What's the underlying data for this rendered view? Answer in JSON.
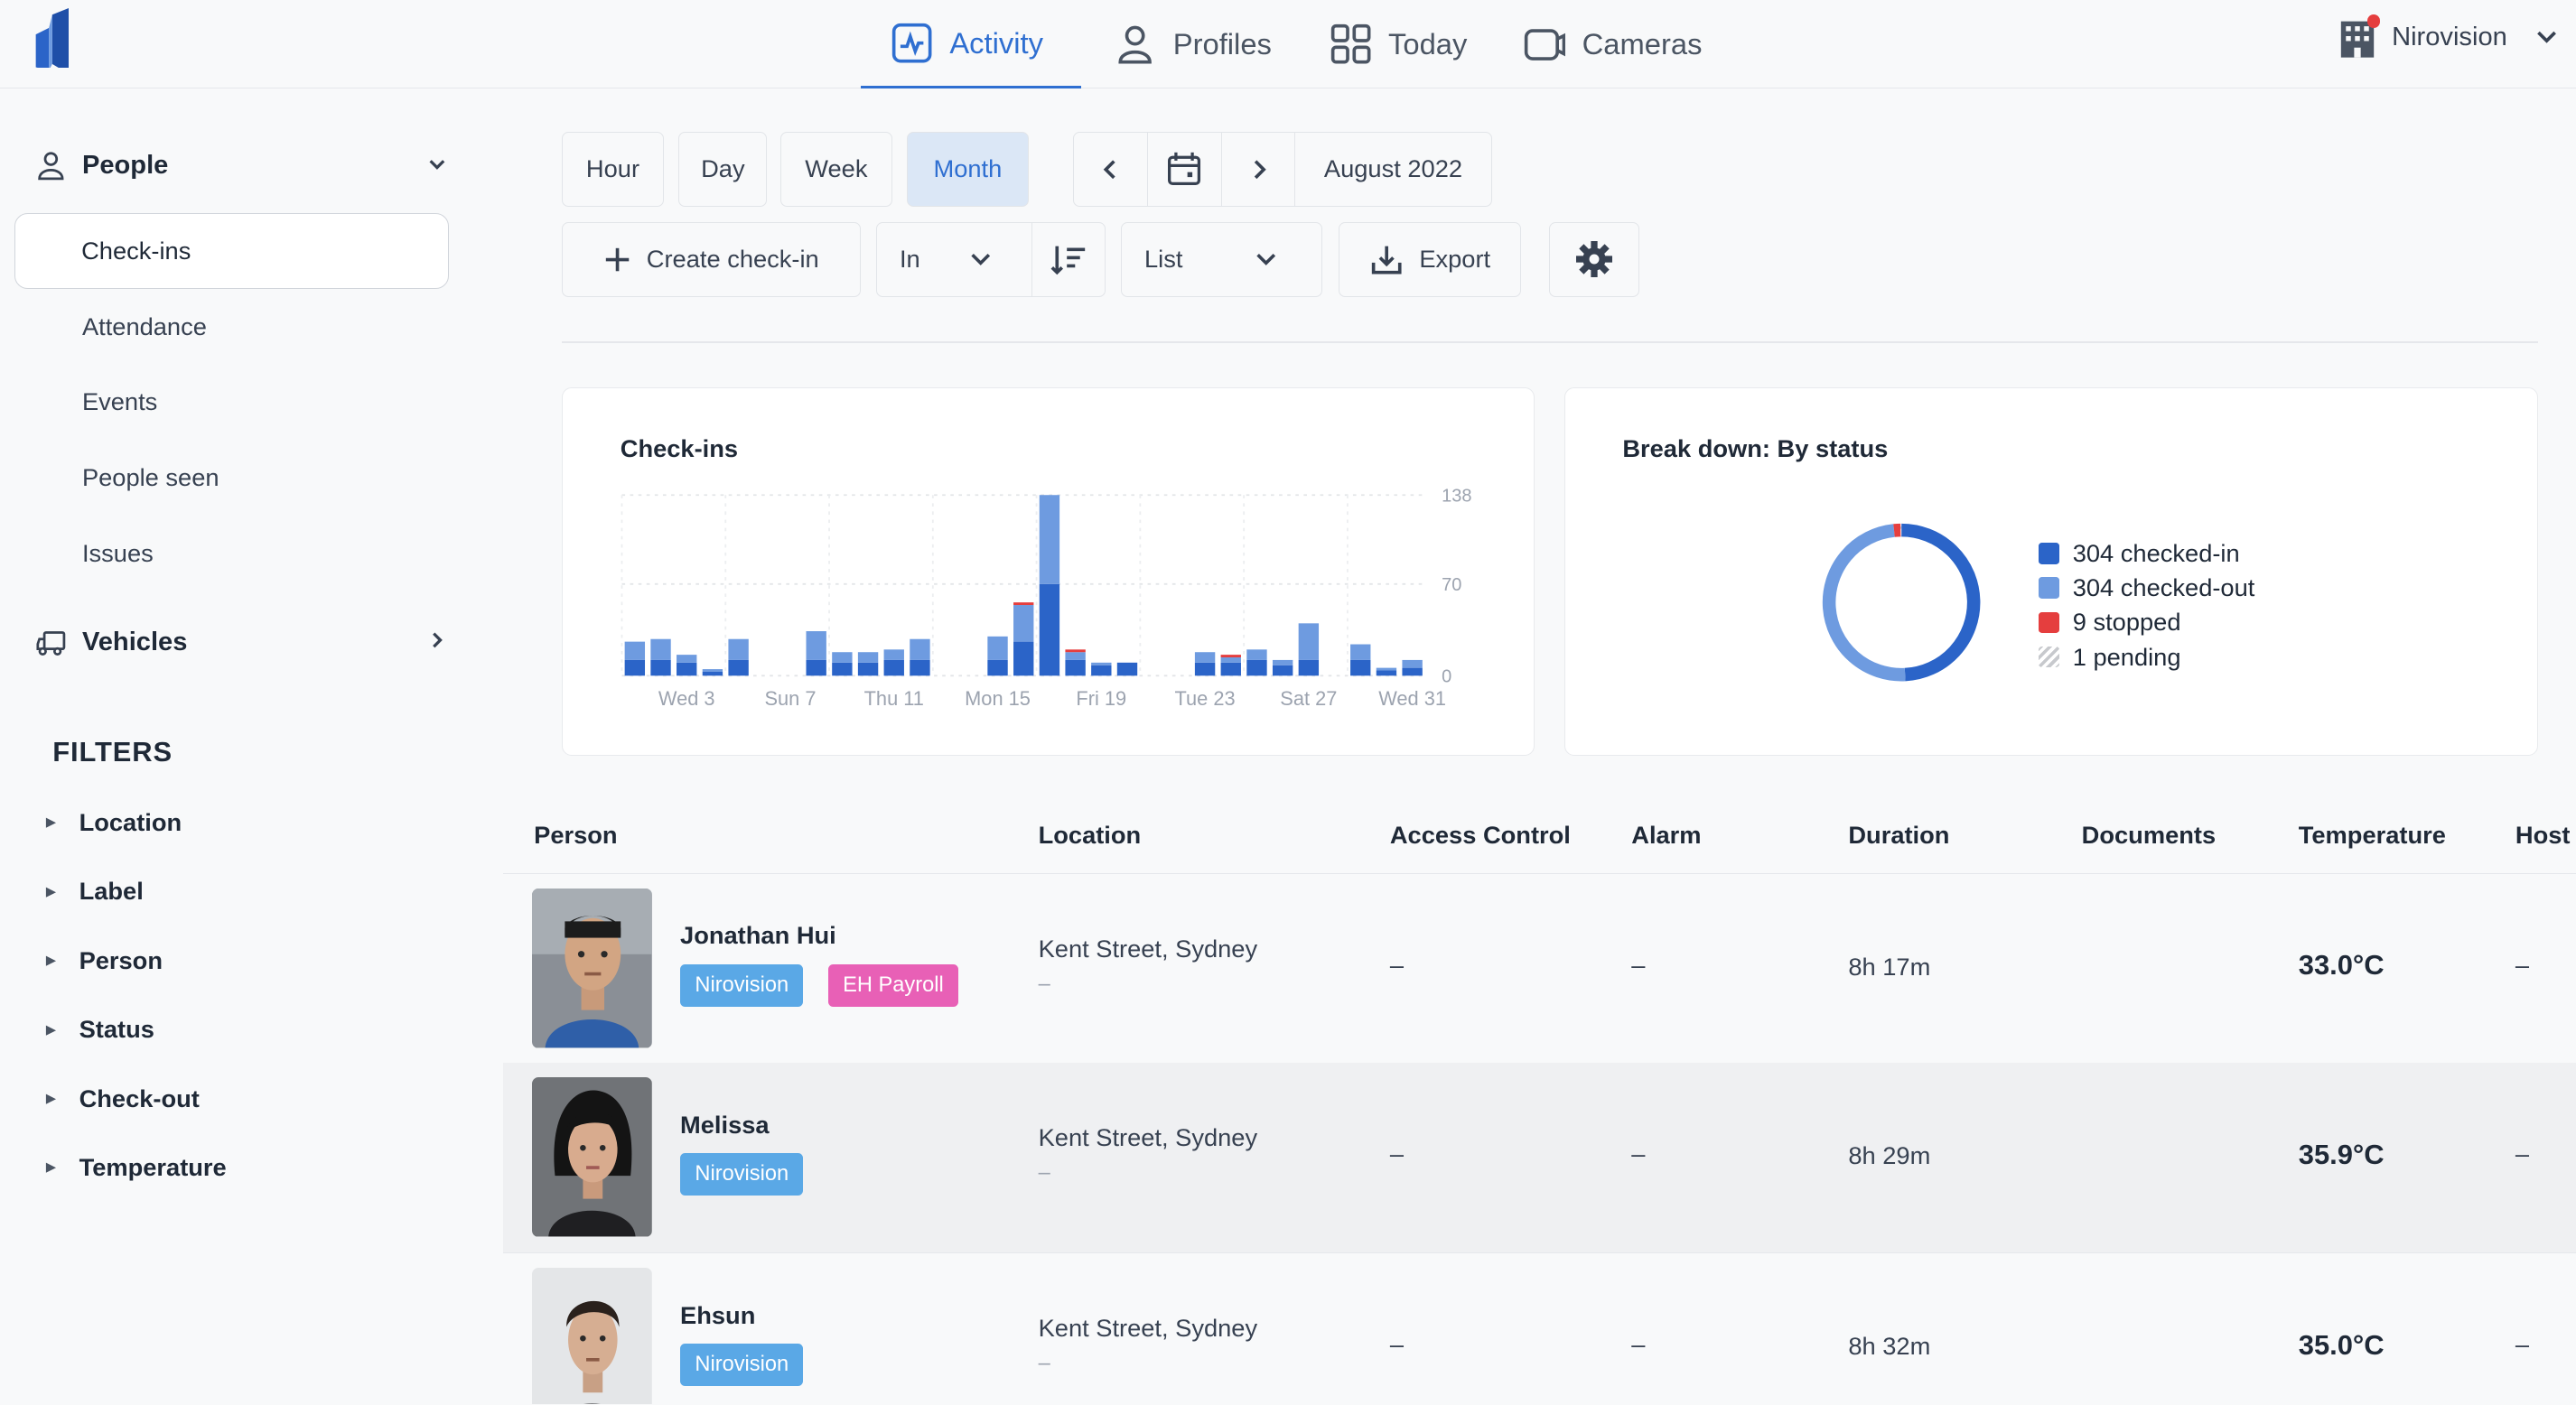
{
  "nav": {
    "tabs": [
      {
        "label": "Activity",
        "icon": "activity-icon"
      },
      {
        "label": "Profiles",
        "icon": "profile-icon"
      },
      {
        "label": "Today",
        "icon": "grid-icon"
      },
      {
        "label": "Cameras",
        "icon": "camera-icon"
      }
    ],
    "org_name": "Nirovision"
  },
  "sidebar": {
    "people_label": "People",
    "people_items": [
      "Check-ins",
      "Attendance",
      "Events",
      "People seen",
      "Issues"
    ],
    "vehicles_label": "Vehicles",
    "filters_title": "FILTERS",
    "filters": [
      "Location",
      "Label",
      "Person",
      "Status",
      "Check-out",
      "Temperature"
    ]
  },
  "toolbar": {
    "ranges": [
      "Hour",
      "Day",
      "Week",
      "Month"
    ],
    "active_range": "Month",
    "period": "August 2022",
    "create_label": "Create check-in",
    "direction": "In",
    "view": "List",
    "export_label": "Export"
  },
  "chart_data": [
    {
      "type": "bar",
      "title": "Check-ins",
      "x_tick_labels": [
        "Wed 3",
        "Sun 7",
        "Thu 11",
        "Mon 15",
        "Fri 19",
        "Tue 23",
        "Sat 27",
        "Wed 31"
      ],
      "y_tick_labels": [
        "138",
        "70",
        "0"
      ],
      "ylim": [
        0,
        138
      ],
      "stacked": true,
      "days": [
        1,
        2,
        3,
        4,
        5,
        6,
        7,
        8,
        9,
        10,
        11,
        12,
        13,
        14,
        15,
        16,
        17,
        18,
        19,
        20,
        21,
        22,
        23,
        24,
        25,
        26,
        27,
        28,
        29,
        30,
        31
      ],
      "series": [
        {
          "color": "#2b64c8",
          "values": [
            12,
            12,
            10,
            3,
            12,
            0,
            0,
            12,
            10,
            10,
            12,
            12,
            0,
            0,
            12,
            26,
            70,
            12,
            8,
            10,
            0,
            0,
            10,
            10,
            12,
            8,
            12,
            0,
            12,
            4,
            6
          ]
        },
        {
          "color": "#6e9be0",
          "values": [
            14,
            16,
            6,
            2,
            16,
            0,
            0,
            22,
            8,
            8,
            8,
            16,
            0,
            0,
            18,
            28,
            68,
            6,
            2,
            0,
            0,
            0,
            8,
            4,
            8,
            4,
            28,
            0,
            12,
            2,
            6
          ]
        },
        {
          "color": "#e53e3e",
          "values": [
            0,
            0,
            0,
            0,
            0,
            0,
            0,
            0,
            0,
            0,
            0,
            0,
            0,
            0,
            0,
            2,
            0,
            2,
            0,
            0,
            0,
            0,
            0,
            2,
            0,
            0,
            0,
            0,
            0,
            0,
            0
          ]
        }
      ]
    },
    {
      "type": "pie",
      "title": "Break down: By status",
      "slices": [
        {
          "label": "304 checked-in",
          "value": 304,
          "color": "#2b64c8"
        },
        {
          "label": "304 checked-out",
          "value": 304,
          "color": "#6e9be0"
        },
        {
          "label": "9 stopped",
          "value": 9,
          "color": "#e53e3e"
        },
        {
          "label": "1 pending",
          "value": 1,
          "color": "hatched"
        }
      ]
    }
  ],
  "table": {
    "headers": [
      "Person",
      "Location",
      "Access Control",
      "Alarm",
      "Duration",
      "Documents",
      "Temperature",
      "Host"
    ],
    "rows": [
      {
        "name": "Jonathan Hui",
        "tags": [
          "Nirovision",
          "EH Payroll"
        ],
        "location": "Kent Street, Sydney",
        "location_sub": "–",
        "access": "–",
        "alarm": "–",
        "duration": "8h 17m",
        "temperature": "33.0°C",
        "host": "–"
      },
      {
        "name": "Melissa",
        "tags": [
          "Nirovision"
        ],
        "location": "Kent Street, Sydney",
        "location_sub": "–",
        "access": "–",
        "alarm": "–",
        "duration": "8h 29m",
        "temperature": "35.9°C",
        "host": "–"
      },
      {
        "name": "Ehsun",
        "tags": [
          "Nirovision"
        ],
        "location": "Kent Street, Sydney",
        "location_sub": "–",
        "access": "–",
        "alarm": "–",
        "duration": "8h 32m",
        "temperature": "35.0°C",
        "host": "–"
      }
    ]
  }
}
